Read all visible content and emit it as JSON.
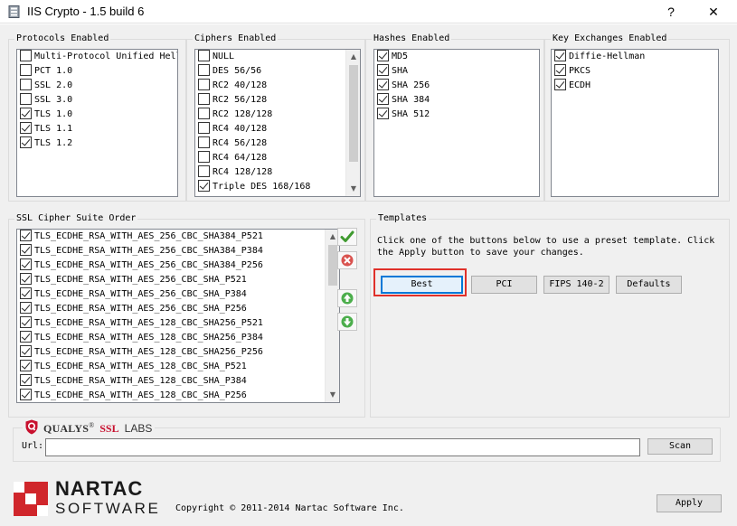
{
  "window": {
    "title": "IIS Crypto - 1.5 build 6",
    "help_label": "?",
    "close_label": "✕"
  },
  "protocols": {
    "label": "Protocols Enabled",
    "items": [
      {
        "label": "Multi-Protocol Unified Hell",
        "checked": false
      },
      {
        "label": "PCT 1.0",
        "checked": false
      },
      {
        "label": "SSL 2.0",
        "checked": false
      },
      {
        "label": "SSL 3.0",
        "checked": false
      },
      {
        "label": "TLS 1.0",
        "checked": true
      },
      {
        "label": "TLS 1.1",
        "checked": true
      },
      {
        "label": "TLS 1.2",
        "checked": true
      }
    ]
  },
  "ciphers": {
    "label": "Ciphers Enabled",
    "items": [
      {
        "label": "NULL",
        "checked": false
      },
      {
        "label": "DES 56/56",
        "checked": false
      },
      {
        "label": "RC2 40/128",
        "checked": false
      },
      {
        "label": "RC2 56/128",
        "checked": false
      },
      {
        "label": "RC2 128/128",
        "checked": false
      },
      {
        "label": "RC4 40/128",
        "checked": false
      },
      {
        "label": "RC4 56/128",
        "checked": false
      },
      {
        "label": "RC4 64/128",
        "checked": false
      },
      {
        "label": "RC4 128/128",
        "checked": false
      },
      {
        "label": "Triple DES 168/168",
        "checked": true
      }
    ]
  },
  "hashes": {
    "label": "Hashes Enabled",
    "items": [
      {
        "label": "MD5",
        "checked": true
      },
      {
        "label": "SHA",
        "checked": true
      },
      {
        "label": "SHA 256",
        "checked": true
      },
      {
        "label": "SHA 384",
        "checked": true
      },
      {
        "label": "SHA 512",
        "checked": true
      }
    ]
  },
  "key_exchanges": {
    "label": "Key Exchanges Enabled",
    "items": [
      {
        "label": "Diffie-Hellman",
        "checked": true
      },
      {
        "label": "PKCS",
        "checked": true
      },
      {
        "label": "ECDH",
        "checked": true
      }
    ]
  },
  "suite_order": {
    "label": "SSL Cipher Suite Order",
    "items": [
      {
        "label": "TLS_ECDHE_RSA_WITH_AES_256_CBC_SHA384_P521",
        "checked": true
      },
      {
        "label": "TLS_ECDHE_RSA_WITH_AES_256_CBC_SHA384_P384",
        "checked": true
      },
      {
        "label": "TLS_ECDHE_RSA_WITH_AES_256_CBC_SHA384_P256",
        "checked": true
      },
      {
        "label": "TLS_ECDHE_RSA_WITH_AES_256_CBC_SHA_P521",
        "checked": true
      },
      {
        "label": "TLS_ECDHE_RSA_WITH_AES_256_CBC_SHA_P384",
        "checked": true
      },
      {
        "label": "TLS_ECDHE_RSA_WITH_AES_256_CBC_SHA_P256",
        "checked": true
      },
      {
        "label": "TLS_ECDHE_RSA_WITH_AES_128_CBC_SHA256_P521",
        "checked": true
      },
      {
        "label": "TLS_ECDHE_RSA_WITH_AES_128_CBC_SHA256_P384",
        "checked": true
      },
      {
        "label": "TLS_ECDHE_RSA_WITH_AES_128_CBC_SHA256_P256",
        "checked": true
      },
      {
        "label": "TLS_ECDHE_RSA_WITH_AES_128_CBC_SHA_P521",
        "checked": true
      },
      {
        "label": "TLS_ECDHE_RSA_WITH_AES_128_CBC_SHA_P384",
        "checked": true
      },
      {
        "label": "TLS_ECDHE_RSA_WITH_AES_128_CBC_SHA_P256",
        "checked": true
      }
    ]
  },
  "templates": {
    "label": "Templates",
    "description_line1": "Click one of the buttons below to use a preset template. Click",
    "description_line2": "the Apply button to save your changes.",
    "buttons": {
      "best": "Best",
      "pci": "PCI",
      "fips": "FIPS 140-2",
      "defaults": "Defaults"
    }
  },
  "qualys": {
    "logo_brand": "QUALYS",
    "logo_ssl": "SSL",
    "logo_labs": "LABS",
    "url_label": "Url:",
    "url_value": "",
    "scan_label": "Scan"
  },
  "footer": {
    "logo_top": "NARTAC",
    "logo_bottom": "SOFTWARE",
    "copyright": "Copyright © 2011-2014 Nartac Software Inc.",
    "apply_label": "Apply"
  },
  "colors": {
    "highlight_box": "#e0302a",
    "nartac_red": "#d0262b",
    "qualys_red": "#c8102e"
  }
}
